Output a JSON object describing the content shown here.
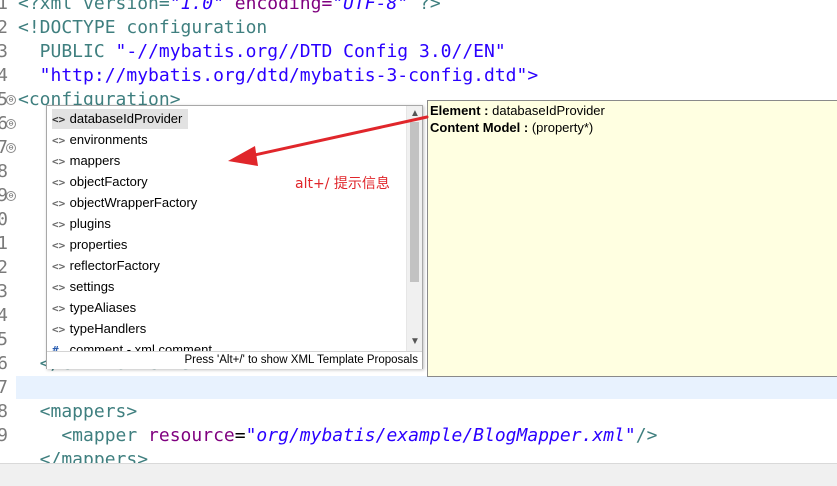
{
  "editor": {
    "line_numbers": [
      "1",
      "2",
      "3",
      "4",
      "5",
      "6",
      "7",
      "8",
      "9",
      "0",
      "1",
      "2",
      "3",
      "4",
      "5",
      "6",
      "7",
      "8",
      "9"
    ],
    "lines": {
      "l1a": "<?xml version=",
      "l1b": "\"1.0\"",
      "l1c": " encoding=",
      "l1d": "\"UTF-8\"",
      "l1e": " ?>",
      "l2a": "<!DOCTYPE ",
      "l2b": "configuration",
      "l3a": "  PUBLIC ",
      "l3b": "\"-//mybatis.org//DTD Config 3.0//EN\"",
      "l4": "  \"http://mybatis.org/dtd/mybatis-3-config.dtd\">",
      "l5": "<configuration>",
      "l15": "  </environments>",
      "l17": "  <mappers>",
      "l18a": "    <mapper ",
      "l18b": "resource",
      "l18c": "=",
      "l18d": "\"org/mybatis/example/BlogMapper.xml\"",
      "l18e": "/>",
      "l19": "  </mappers>"
    },
    "fold_glyph": "⊖"
  },
  "proposals": {
    "items": [
      {
        "icon": "<>",
        "label": "databaseIdProvider"
      },
      {
        "icon": "<>",
        "label": "environments"
      },
      {
        "icon": "<>",
        "label": "mappers"
      },
      {
        "icon": "<>",
        "label": "objectFactory"
      },
      {
        "icon": "<>",
        "label": "objectWrapperFactory"
      },
      {
        "icon": "<>",
        "label": "plugins"
      },
      {
        "icon": "<>",
        "label": "properties"
      },
      {
        "icon": "<>",
        "label": "reflectorFactory"
      },
      {
        "icon": "<>",
        "label": "settings"
      },
      {
        "icon": "<>",
        "label": "typeAliases"
      },
      {
        "icon": "<>",
        "label": "typeHandlers"
      },
      {
        "icon": "#",
        "label": "comment - xml comment"
      }
    ],
    "status": "Press 'Alt+/' to show XML Template Proposals",
    "scroll_up": "▲",
    "scroll_down": "▼"
  },
  "info": {
    "element_label": "Element : ",
    "element_value": "databaseIdProvider",
    "model_label": "Content Model : ",
    "model_value": "(property*)"
  },
  "annotation": {
    "text": "alt+/ 提示信息"
  },
  "colors": {
    "accent_red": "#e0262b",
    "info_bg": "#ffffe1",
    "selection": "#e2e2e2"
  }
}
